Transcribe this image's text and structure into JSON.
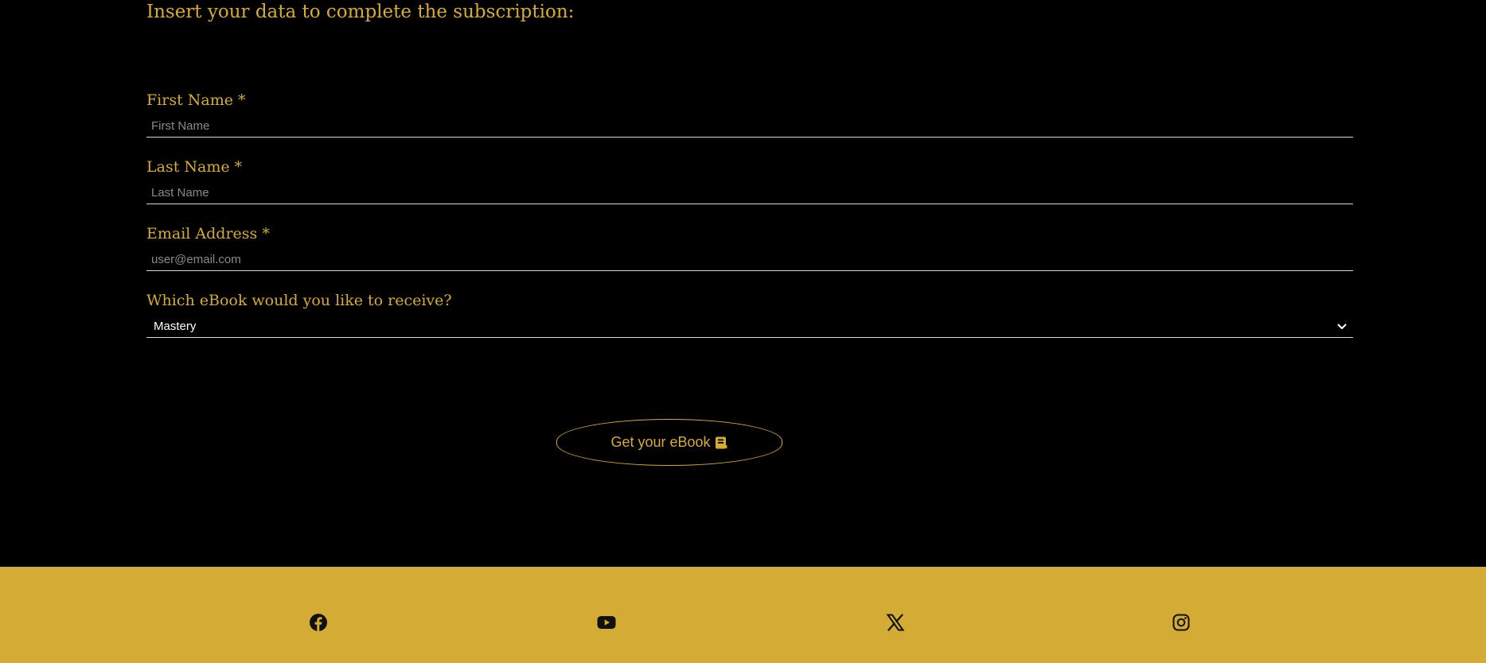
{
  "form": {
    "intro": "Insert your data to complete the subscription:",
    "first_name": {
      "label": "First Name *",
      "placeholder": "First Name"
    },
    "last_name": {
      "label": "Last Name *",
      "placeholder": "Last Name"
    },
    "email": {
      "label": "Email Address *",
      "placeholder": "user@email.com"
    },
    "ebook": {
      "label": "Which eBook would you like to receive?",
      "selected": "Mastery"
    },
    "submit_label": "Get your eBook"
  },
  "footer": {
    "social_icons": [
      "facebook-icon",
      "youtube-icon",
      "x-icon",
      "instagram-icon"
    ]
  },
  "colors": {
    "background": "#000000",
    "accent": "#d4ac35",
    "input_line": "#d8d8d8",
    "placeholder": "#8a8a8a"
  }
}
